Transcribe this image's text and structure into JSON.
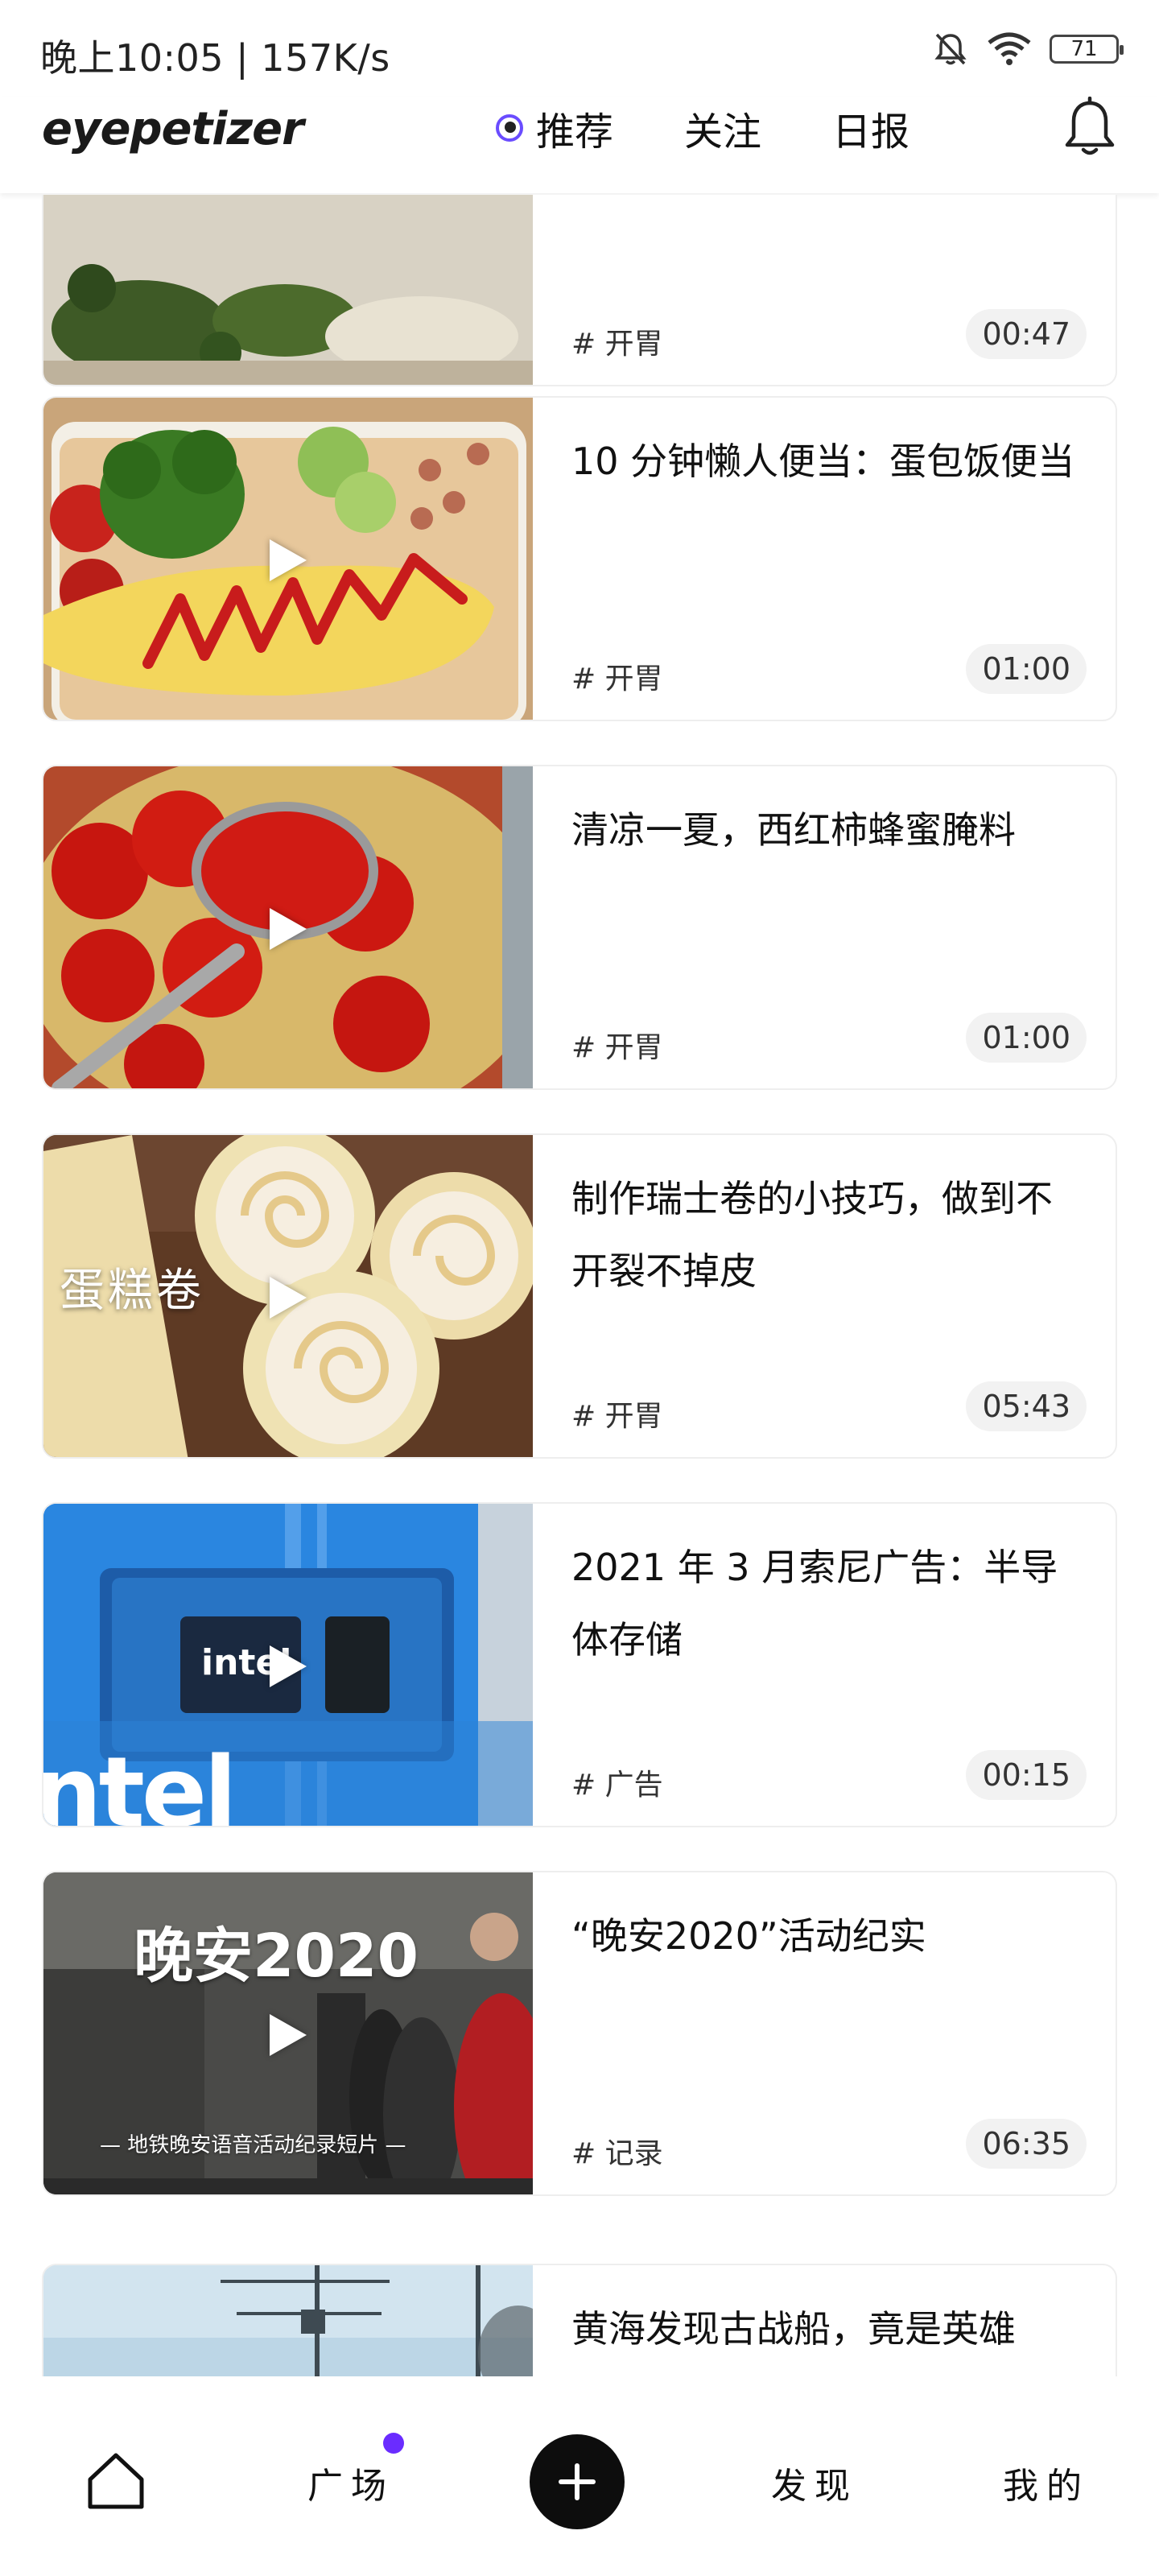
{
  "status_bar": {
    "text": "晚上10:05 | 157K/s",
    "battery": "71"
  },
  "header": {
    "logo": "eyepetizer",
    "tabs": [
      {
        "label": "推荐"
      },
      {
        "label": "关注"
      },
      {
        "label": "日报"
      }
    ]
  },
  "feed": [
    {
      "title": "",
      "tag": "# 开胃",
      "duration": "00:47"
    },
    {
      "title": "10 分钟懒人便当：蛋包饭便当",
      "tag": "# 开胃",
      "duration": "01:00"
    },
    {
      "title": "清凉一夏，西红柿蜂蜜腌料",
      "tag": "# 开胃",
      "duration": "01:00"
    },
    {
      "title": "制作瑞士卷的小技巧，做到不开裂不掉皮",
      "tag": "# 开胃",
      "duration": "05:43",
      "thumb_text": "蛋糕卷"
    },
    {
      "title": "2021 年 3 月索尼广告：半导体存储",
      "tag": "# 广告",
      "duration": "00:15",
      "thumb_text": "intel"
    },
    {
      "title": "“晚安2020”活动纪实",
      "tag": "# 记录",
      "duration": "06:35",
      "thumb_text": "晚安2020",
      "thumb_subtext": "— 地铁晚安语音活动纪录短片 —"
    },
    {
      "title": "黄海发现古战船，竟是英雄",
      "tag": "",
      "duration": ""
    }
  ],
  "bottom_nav": {
    "square_label": "广场",
    "discover_label": "发现",
    "mine_label": "我的"
  },
  "colors": {
    "accent": "#6a2cff",
    "background": "#ffffff"
  },
  "icons": [
    "mute-icon",
    "wifi-icon",
    "battery-icon",
    "bell-icon",
    "play-icon",
    "home-icon",
    "plus-icon"
  ]
}
